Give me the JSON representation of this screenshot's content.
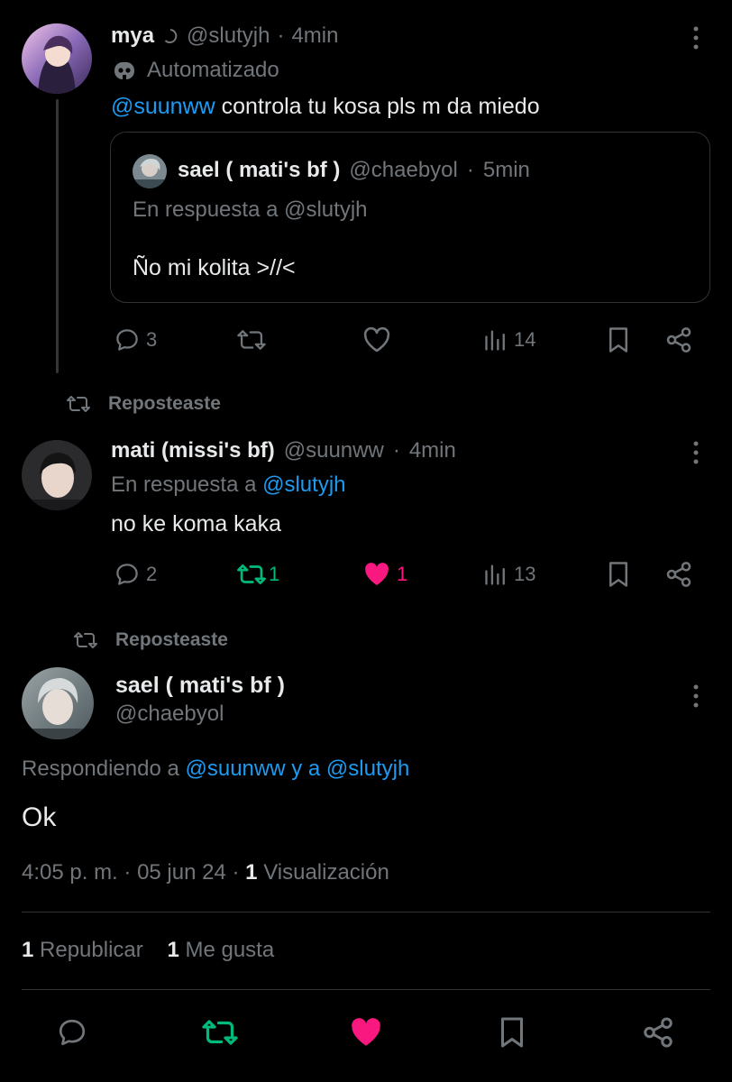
{
  "colors": {
    "background": "#000000",
    "text": "#e7e9ea",
    "muted": "#71767b",
    "link": "#1d9bf0",
    "repost_green": "#00ba7c",
    "like_pink": "#f91880"
  },
  "post1": {
    "name": "mya",
    "handle": "@slutyjh",
    "sep": "·",
    "time": "4min",
    "badge_label": "Automatizado",
    "text_mention": "@suunww",
    "text_body": " controla tu kosa pls m da miedo",
    "quote": {
      "name": "sael ( mati's bf )",
      "handle": "@chaebyol",
      "sep": "·",
      "time": "5min",
      "reply_to": "En respuesta a @slutyjh",
      "text": "Ño mi kolita >//<"
    },
    "actions": {
      "replies": "3",
      "reposts": "",
      "likes": "",
      "views": "14"
    }
  },
  "post2": {
    "repost_label": "Reposteaste",
    "name": "mati (missi's bf)",
    "handle": "@suunww",
    "sep": "·",
    "time": "4min",
    "reply_prefix": "En respuesta a ",
    "reply_mention": "@slutyjh",
    "text": "no ke koma kaka",
    "actions": {
      "replies": "2",
      "reposts": "1",
      "likes": "1",
      "views": "13"
    }
  },
  "post3": {
    "repost_label": "Reposteaste",
    "name": "sael ( mati's bf )",
    "handle": "@chaebyol",
    "reply_prefix": "Respondiendo a ",
    "reply_mention1": "@suunww",
    "reply_joiner": " y a ",
    "reply_mention2": "@slutyjh",
    "text": "Ok",
    "time": "4:05 p. m.",
    "date": "05 jun 24",
    "views_count": "1",
    "views_label": "Visualización",
    "reposts_count": "1",
    "reposts_label": "Republicar",
    "likes_count": "1",
    "likes_label": "Me gusta"
  },
  "icons": [
    "verified-swirl-icon",
    "robot-icon",
    "reply-icon",
    "repost-icon",
    "like-icon",
    "views-icon",
    "bookmark-icon",
    "share-icon",
    "more-icon"
  ]
}
